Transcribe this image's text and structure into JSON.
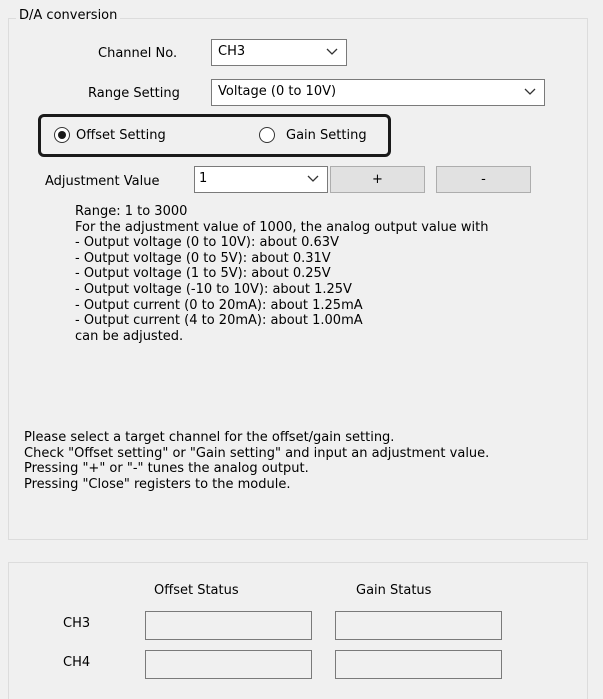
{
  "group": {
    "title": "D/A conversion"
  },
  "channel": {
    "label": "Channel No.",
    "value": "CH3"
  },
  "range": {
    "label": "Range Setting",
    "value": "Voltage (0 to 10V)"
  },
  "mode": {
    "offset_label": "Offset Setting",
    "gain_label": "Gain Setting",
    "selected": "offset"
  },
  "adjust": {
    "label": "Adjustment Value",
    "value": "1",
    "plus_label": "+",
    "minus_label": "-"
  },
  "info_lines": [
    "Range: 1 to 3000",
    "For the adjustment value of 1000, the analog output value with",
    "- Output voltage (0 to 10V): about 0.63V",
    "- Output voltage (0 to 5V): about 0.31V",
    "- Output voltage (1 to 5V): about 0.25V",
    "- Output voltage (-10 to 10V): about 1.25V",
    "- Output current (0 to 20mA): about 1.25mA",
    "- Output current (4 to 20mA): about 1.00mA",
    "can be adjusted."
  ],
  "help_lines": [
    "Please select a target channel for the offset/gain setting.",
    "Check \"Offset setting\" or \"Gain setting\" and input an adjustment value.",
    "Pressing \"+\" or \"-\" tunes the analog output.",
    "Pressing \"Close\" registers to the module."
  ],
  "status": {
    "offset_header": "Offset Status",
    "gain_header": "Gain Status",
    "rows": [
      {
        "channel": "CH3",
        "offset": "",
        "gain": ""
      },
      {
        "channel": "CH4",
        "offset": "",
        "gain": ""
      }
    ]
  },
  "colors": {
    "background": "#f0f0f0",
    "highlight": "#1a1a1a",
    "button_face": "#e1e1e1"
  }
}
